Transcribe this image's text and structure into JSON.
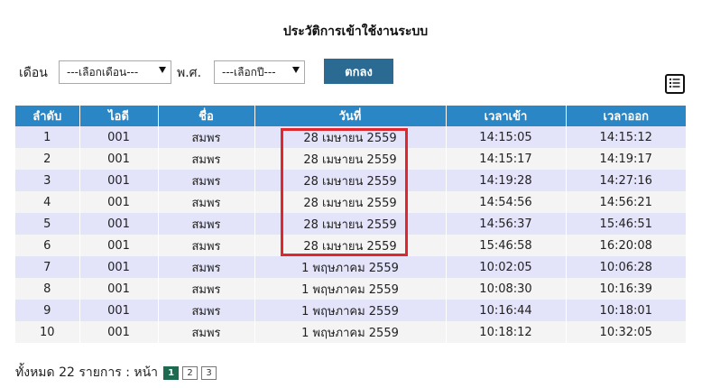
{
  "page": {
    "title": "ประวัติการเข้าใช้งานระบบ"
  },
  "filter": {
    "month_label": "เดือน",
    "month_select": "---เลือกเดือน---",
    "year_label": "พ.ศ.",
    "year_select": "---เลือกปี---",
    "submit": "ตกลง"
  },
  "table": {
    "headers": [
      "ลำดับ",
      "ไอดี",
      "ชื่อ",
      "วันที่",
      "เวลาเข้า",
      "เวลาออก"
    ],
    "rows": [
      [
        "1",
        "001",
        "สมพร",
        "28 เมษายน 2559",
        "14:15:05",
        "14:15:12"
      ],
      [
        "2",
        "001",
        "สมพร",
        "28 เมษายน 2559",
        "14:15:17",
        "14:19:17"
      ],
      [
        "3",
        "001",
        "สมพร",
        "28 เมษายน 2559",
        "14:19:28",
        "14:27:16"
      ],
      [
        "4",
        "001",
        "สมพร",
        "28 เมษายน 2559",
        "14:54:56",
        "14:56:21"
      ],
      [
        "5",
        "001",
        "สมพร",
        "28 เมษายน 2559",
        "14:56:37",
        "15:46:51"
      ],
      [
        "6",
        "001",
        "สมพร",
        "28 เมษายน 2559",
        "15:46:58",
        "16:20:08"
      ],
      [
        "7",
        "001",
        "สมพร",
        "1 พฤษภาคม 2559",
        "10:02:05",
        "10:06:28"
      ],
      [
        "8",
        "001",
        "สมพร",
        "1 พฤษภาคม 2559",
        "10:08:30",
        "10:16:39"
      ],
      [
        "9",
        "001",
        "สมพร",
        "1 พฤษภาคม 2559",
        "10:16:44",
        "10:18:01"
      ],
      [
        "10",
        "001",
        "สมพร",
        "1 พฤษภาคม 2559",
        "10:18:12",
        "10:32:05"
      ]
    ]
  },
  "pagination": {
    "summary": "ทั้งหมด 22 รายการ : หน้า",
    "pages": [
      "1",
      "2",
      "3"
    ],
    "current": "1"
  },
  "icons": {
    "toolbar": "list-icon"
  },
  "colors": {
    "header_bg": "#2a86c4",
    "button_bg": "#2b6b93",
    "row_odd": "#e3e3f9",
    "row_even": "#f4f4f4",
    "highlight": "#e0262e",
    "active_page": "#1e6a50"
  }
}
